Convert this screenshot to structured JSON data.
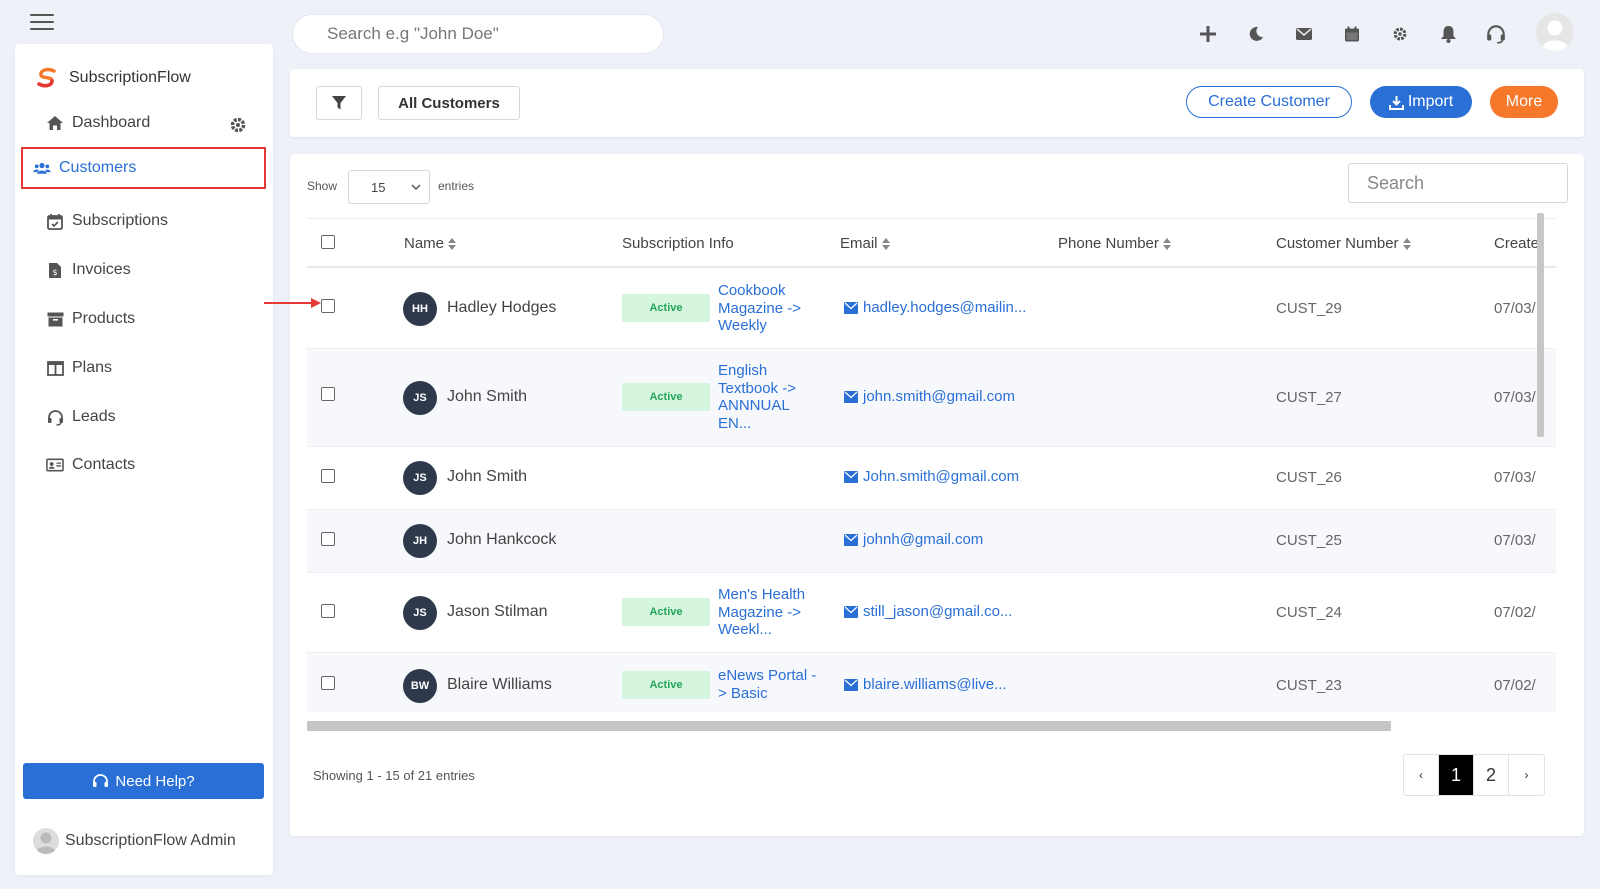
{
  "brand": {
    "name": "SubscriptionFlow"
  },
  "topbar": {
    "search_placeholder": "Search e.g \"John Doe\"",
    "icons": [
      "plus-icon",
      "moon-icon",
      "mail-icon",
      "calendar-icon",
      "gear-icon",
      "bell-icon",
      "headset-icon"
    ]
  },
  "sidebar": {
    "items": [
      {
        "label": "Dashboard",
        "icon": "home-icon"
      },
      {
        "label": "Customers",
        "icon": "users-icon"
      },
      {
        "label": "Subscriptions",
        "icon": "calendar-check-icon"
      },
      {
        "label": "Invoices",
        "icon": "invoice-icon"
      },
      {
        "label": "Products",
        "icon": "box-icon"
      },
      {
        "label": "Plans",
        "icon": "columns-icon"
      },
      {
        "label": "Leads",
        "icon": "headset-icon"
      },
      {
        "label": "Contacts",
        "icon": "contact-card-icon"
      }
    ],
    "help_label": "Need Help?",
    "user_name": "SubscriptionFlow Admin"
  },
  "toolbar": {
    "view_label": "All Customers",
    "create_label": "Create Customer",
    "import_label": "Import",
    "more_label": "More"
  },
  "table": {
    "show_label": "Show",
    "entries_value": "15",
    "entries_label": "entries",
    "search_placeholder": "Search",
    "headers": {
      "name": "Name",
      "subscription": "Subscription Info",
      "email": "Email",
      "phone": "Phone Number",
      "customer_number": "Customer Number",
      "created": "Create"
    },
    "rows": [
      {
        "initials": "HH",
        "name": "Hadley Hodges",
        "status": "Active",
        "plan": "Cookbook Magazine -> Weekly",
        "email": "hadley.hodges@mailin...",
        "phone": "",
        "customer_number": "CUST_29",
        "created": "07/03/"
      },
      {
        "initials": "JS",
        "name": "John Smith",
        "status": "Active",
        "plan": "English Textbook -> ANNNUAL EN...",
        "email": "john.smith@gmail.com",
        "phone": "",
        "customer_number": "CUST_27",
        "created": "07/03/"
      },
      {
        "initials": "JS",
        "name": "John Smith",
        "status": "",
        "plan": "",
        "email": "John.smith@gmail.com",
        "phone": "",
        "customer_number": "CUST_26",
        "created": "07/03/"
      },
      {
        "initials": "JH",
        "name": "John Hankcock",
        "status": "",
        "plan": "",
        "email": "johnh@gmail.com",
        "phone": "",
        "customer_number": "CUST_25",
        "created": "07/03/"
      },
      {
        "initials": "JS",
        "name": "Jason Stilman",
        "status": "Active",
        "plan": "Men's Health Magazine -> Weekl...",
        "email": "still_jason@gmail.co...",
        "phone": "",
        "customer_number": "CUST_24",
        "created": "07/02/"
      },
      {
        "initials": "BW",
        "name": "Blaire Williams",
        "status": "Active",
        "plan": "eNews Portal -> Basic",
        "email": "blaire.williams@live...",
        "phone": "",
        "customer_number": "CUST_23",
        "created": "07/02/"
      }
    ],
    "footer_info": "Showing 1 - 15 of 21 entries",
    "pagination": {
      "prev": "‹",
      "pages": [
        "1",
        "2"
      ],
      "current": "1",
      "next": "›"
    }
  },
  "colors": {
    "primary": "#2a6fd6",
    "accent_orange": "#f5782b",
    "active_badge_bg": "#d6f5df",
    "active_badge_text": "#27a55a",
    "highlight_red": "#e53935"
  }
}
